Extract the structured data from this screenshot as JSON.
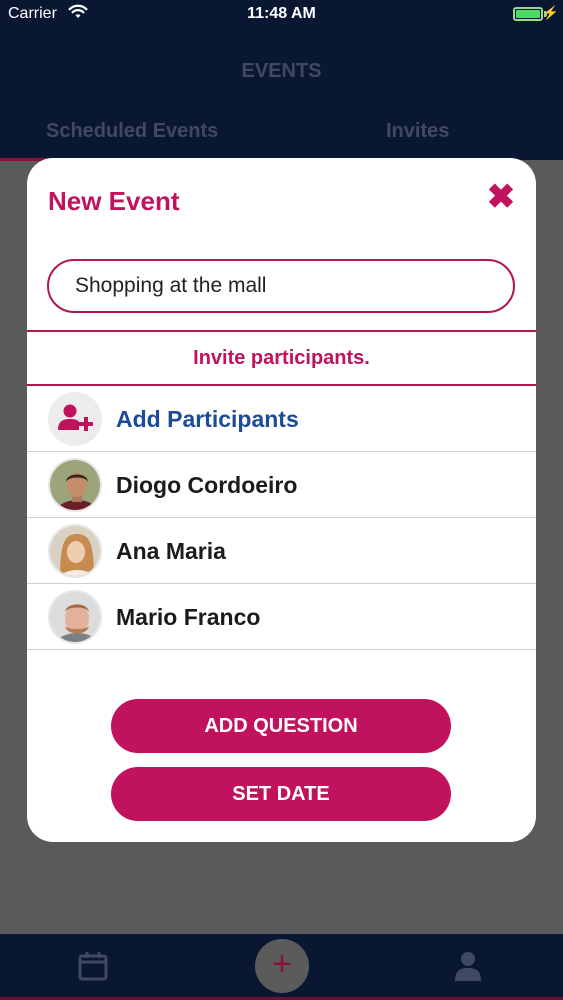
{
  "status_bar": {
    "carrier": "Carrier",
    "time": "11:48 AM"
  },
  "header": {
    "title": "EVENTS",
    "tabs": [
      "Scheduled Events",
      "Invites"
    ]
  },
  "modal": {
    "title": "New Event",
    "event_name_value": "Shopping at the mall",
    "invite_banner": "Invite participants.",
    "add_participants_label": "Add Participants",
    "participants": [
      "Diogo Cordoeiro",
      "Ana Maria",
      "Mario Franco"
    ],
    "add_question_label": "ADD QUESTION",
    "set_date_label": "SET DATE"
  },
  "colors": {
    "accent": "#c0125d",
    "navy": "#0a1733",
    "link_blue": "#1d4b97"
  },
  "icons": [
    "wifi-icon",
    "battery-icon",
    "close-icon",
    "add-user-icon",
    "calendar-icon",
    "plus-icon",
    "user-icon"
  ]
}
